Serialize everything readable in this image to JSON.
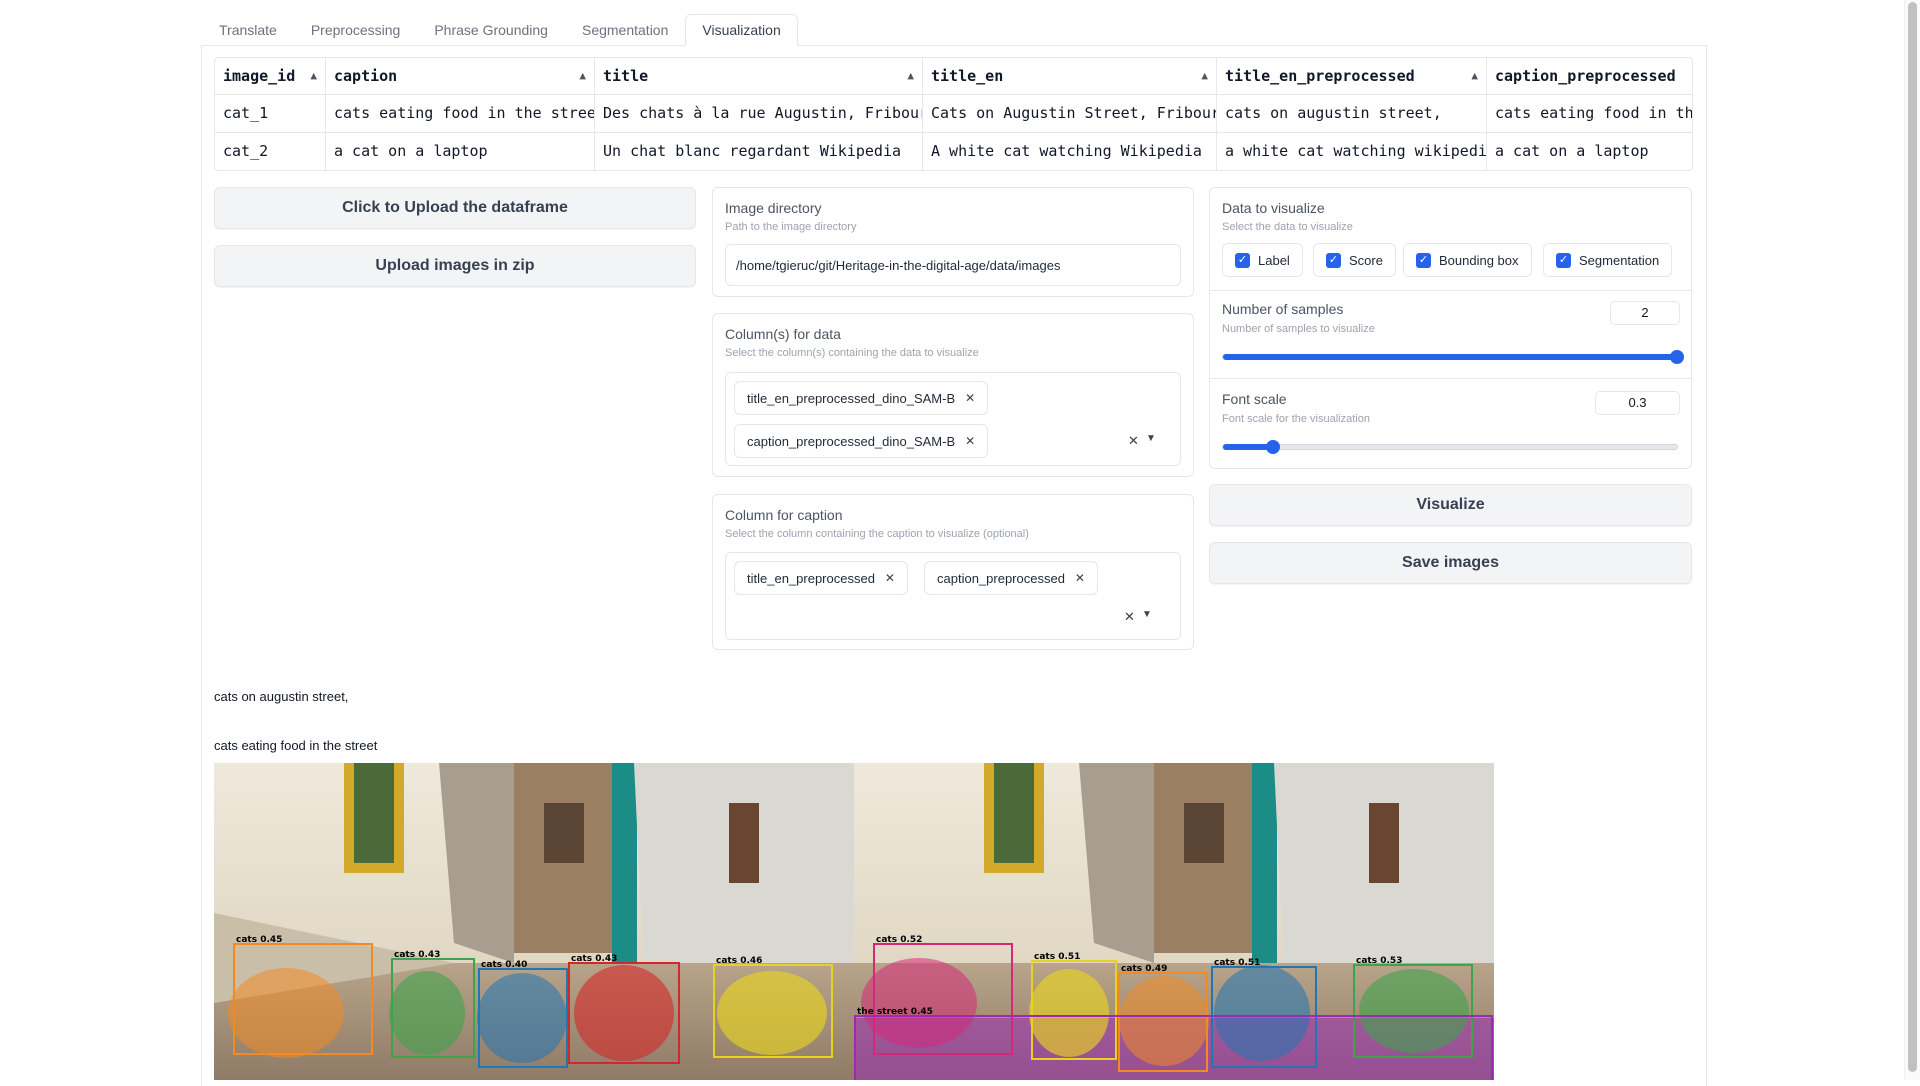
{
  "tabs": [
    "Translate",
    "Preprocessing",
    "Phrase Grounding",
    "Segmentation",
    "Visualization"
  ],
  "table": {
    "columns": [
      "image_id",
      "caption",
      "title",
      "title_en",
      "title_en_preprocessed",
      "caption_preprocessed"
    ],
    "rows": [
      [
        "cat_1",
        "cats eating food in the street",
        "Des chats à la rue Augustin, Fribourg",
        "Cats on Augustin Street, Fribourg",
        "cats on augustin street,",
        "cats eating food in the"
      ],
      [
        "cat_2",
        "a cat on a laptop",
        "Un chat blanc regardant Wikipedia",
        "A white cat watching Wikipedia",
        "a white cat watching wikipedia",
        "a cat on a laptop"
      ]
    ]
  },
  "buttons": {
    "upload_dataframe": "Click to Upload the dataframe",
    "upload_zip": "Upload images in zip",
    "visualize": "Visualize",
    "save_images": "Save images"
  },
  "image_directory": {
    "label": "Image directory",
    "info": "Path to the image directory",
    "value": "/home/tgieruc/git/Heritage-in-the-digital-age/data/images"
  },
  "columns_for_data": {
    "label": "Column(s) for data",
    "info": "Select the column(s) containing the data to visualize",
    "selected": [
      "title_en_preprocessed_dino_SAM-B",
      "caption_preprocessed_dino_SAM-B"
    ]
  },
  "column_for_caption": {
    "label": "Column for caption",
    "info": "Select the column containing the caption to visualize (optional)",
    "selected": [
      "title_en_preprocessed",
      "caption_preprocessed"
    ]
  },
  "data_to_visualize": {
    "label": "Data to visualize",
    "info": "Select the data to visualize",
    "options": [
      "Label",
      "Score",
      "Bounding box",
      "Segmentation"
    ],
    "checked": [
      true,
      true,
      true,
      true
    ]
  },
  "num_samples": {
    "label": "Number of samples",
    "info": "Number of samples to visualize",
    "value": "2",
    "fraction": 1.0
  },
  "font_scale": {
    "label": "Font scale",
    "info": "Font scale for the visualization",
    "value": "0.3",
    "fraction": 0.11
  },
  "captions": [
    "cats on augustin street,",
    "cats eating food in the street"
  ],
  "detections": {
    "left": [
      {
        "label": "cats",
        "score": "0.45",
        "color": "#f08a24"
      },
      {
        "label": "cats",
        "score": "0.43",
        "color": "#3fa34d"
      },
      {
        "label": "cats",
        "score": "0.40",
        "color": "#1f77b4"
      },
      {
        "label": "cats",
        "score": "0.43",
        "color": "#d62728"
      },
      {
        "label": "cats",
        "score": "0.46",
        "color": "#e6d220"
      }
    ],
    "right": [
      {
        "label": "cats",
        "score": "0.52",
        "color": "#d6287a"
      },
      {
        "label": "cats",
        "score": "0.51",
        "color": "#e6d220"
      },
      {
        "label": "cats",
        "score": "0.49",
        "color": "#f08a24"
      },
      {
        "label": "cats",
        "score": "0.51",
        "color": "#1f77b4"
      },
      {
        "label": "cats",
        "score": "0.53",
        "color": "#3fa34d"
      },
      {
        "label": "the street",
        "score": "0.45",
        "color": "#9b2bb5"
      }
    ]
  },
  "colors": {
    "accent": "#2563eb",
    "border": "#e5e7eb",
    "button_bg": "#f3f4f6"
  }
}
